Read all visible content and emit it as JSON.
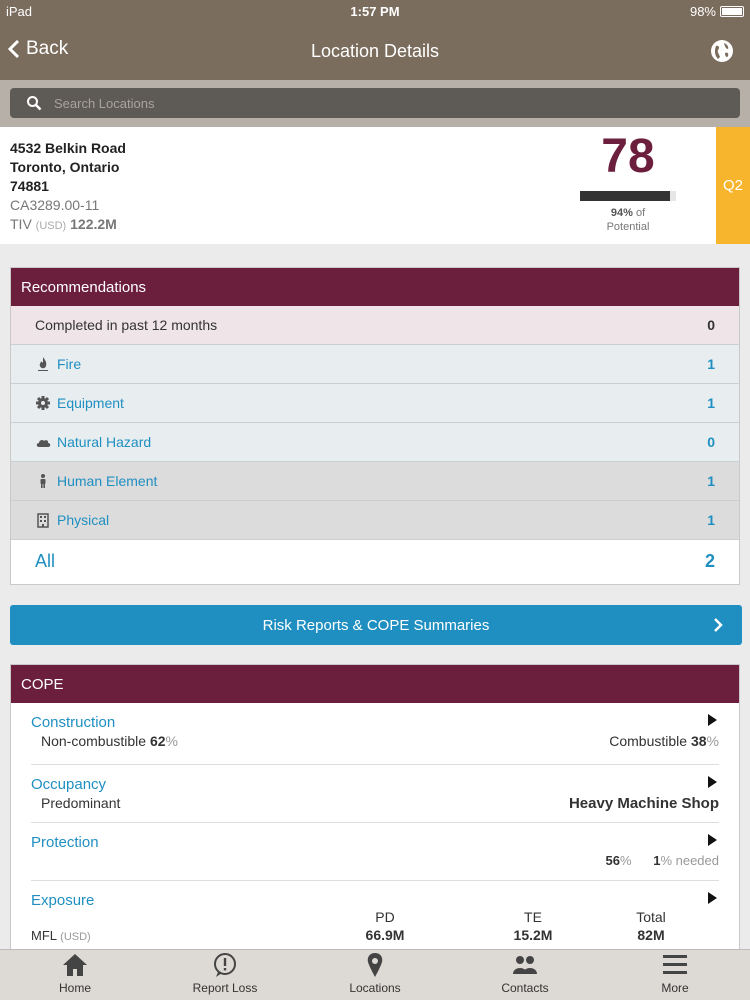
{
  "status_bar": {
    "device": "iPad",
    "time": "1:57 PM",
    "battery": "98%",
    "battery_level": 0.98
  },
  "nav": {
    "back_label": "Back",
    "title": "Location Details",
    "globe_icon": "globe-icon"
  },
  "search": {
    "placeholder": "Search Locations"
  },
  "location": {
    "street": "4532 Belkin Road",
    "city": "Toronto, Ontario",
    "postal": "74881",
    "code": "CA3289.00-11",
    "tiv_label": "TIV",
    "tiv_currency": "(USD)",
    "tiv_value": "122.2M",
    "score": "78",
    "potential_pct": "94%",
    "potential_fraction": 0.94,
    "potential_of": "of",
    "potential_label": "Potential",
    "quarter": "Q2",
    "quarter_color": "#f7b52e"
  },
  "recommendations": {
    "title": "Recommendations",
    "completed_label": "Completed in past 12 months",
    "completed_value": "0",
    "items": [
      {
        "label": "Fire",
        "value": "1",
        "icon": "fire-icon"
      },
      {
        "label": "Equipment",
        "value": "1",
        "icon": "gear-icon"
      },
      {
        "label": "Natural Hazard",
        "value": "0",
        "icon": "cloud-icon"
      },
      {
        "label": "Human Element",
        "value": "1",
        "icon": "person-icon"
      },
      {
        "label": "Physical",
        "value": "1",
        "icon": "building-icon"
      }
    ],
    "all_label": "All",
    "all_value": "2"
  },
  "risk_button": {
    "label": "Risk Reports & COPE Summaries"
  },
  "cope": {
    "title": "COPE",
    "construction": {
      "label": "Construction",
      "left_label": "Non-combustible",
      "left_value": "62",
      "left_unit": "%",
      "right_label": "Combustible",
      "right_value": "38",
      "right_unit": "%"
    },
    "occupancy": {
      "label": "Occupancy",
      "left_label": "Predominant",
      "right_value": "Heavy Machine Shop"
    },
    "protection": {
      "label": "Protection",
      "value1": "56",
      "unit1": "%",
      "value2": "1",
      "unit2": "% needed"
    },
    "exposure": {
      "label": "Exposure",
      "col1": "PD",
      "col2": "TE",
      "col3": "Total",
      "row_label": "MFL",
      "row_currency": "(USD)",
      "v1": "66.9M",
      "v2": "15.2M",
      "v3": "82M"
    }
  },
  "tabs": [
    {
      "label": "Home",
      "icon": "home-icon"
    },
    {
      "label": "Report Loss",
      "icon": "alert-icon"
    },
    {
      "label": "Locations",
      "icon": "map-pin-icon"
    },
    {
      "label": "Contacts",
      "icon": "contacts-icon"
    },
    {
      "label": "More",
      "icon": "menu-icon"
    }
  ],
  "colors": {
    "brand": "#7b6d5d",
    "accent": "#6b1f3d",
    "link": "#1f8fc2"
  }
}
